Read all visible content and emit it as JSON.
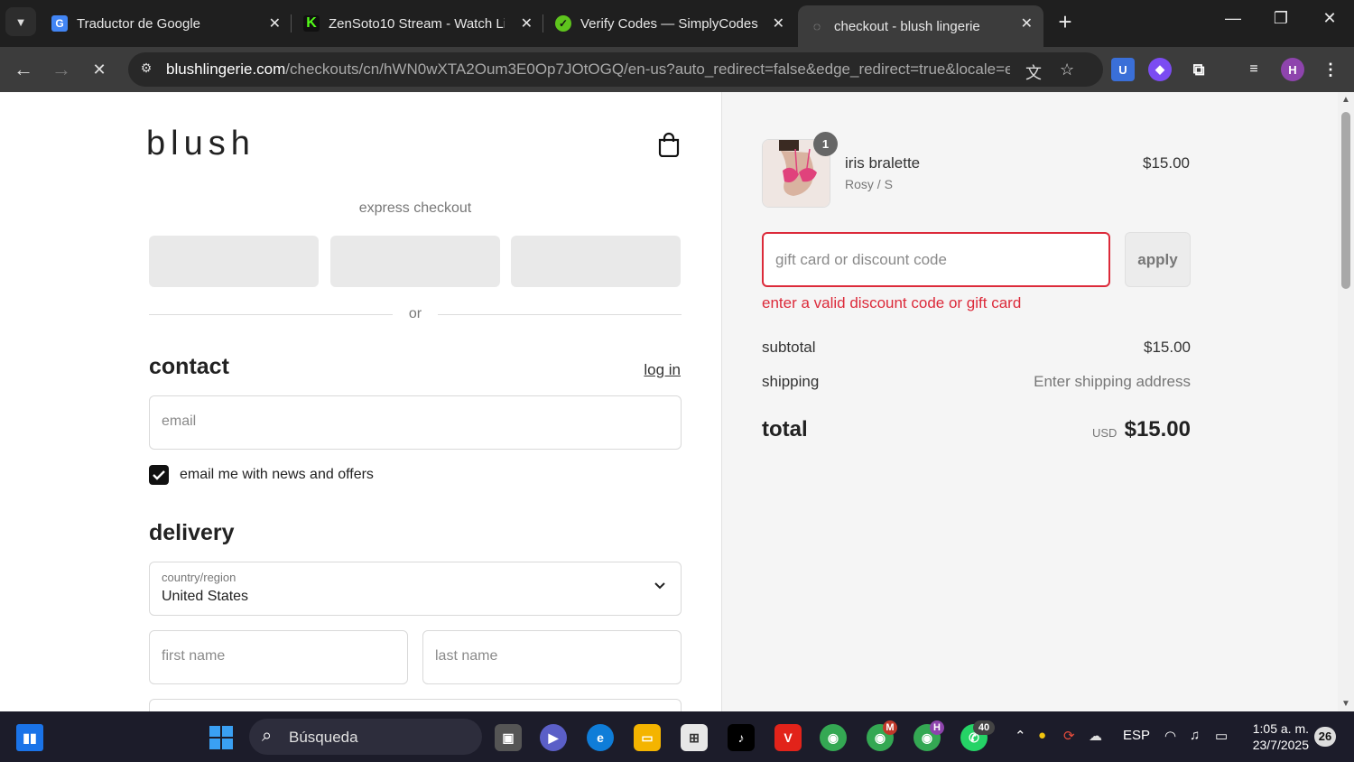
{
  "browser": {
    "tabs": [
      {
        "title": "Traductor de Google",
        "icon": "google-translate-icon"
      },
      {
        "title": "ZenSoto10 Stream - Watch Live",
        "icon": "kick-icon"
      },
      {
        "title": "Verify Codes — SimplyCodes",
        "icon": "simplycodes-icon"
      },
      {
        "title": "checkout - blush lingerie",
        "icon": "loading-icon"
      }
    ],
    "url_host": "blushlingerie.com",
    "url_path": "/checkouts/cn/hWN0wXTA2Oum3E0Op7JOtOGQ/en-us?auto_redirect=false&edge_redirect=true&locale=en-...",
    "profile_initial": "H"
  },
  "checkout": {
    "logo": "blush",
    "express_label": "express checkout",
    "or_label": "or",
    "contact_heading": "contact",
    "login_link": "log in",
    "email_placeholder": "email",
    "newsletter_label": "email me with news and offers",
    "newsletter_checked": true,
    "delivery_heading": "delivery",
    "country_label": "country/region",
    "country_value": "United States",
    "first_name_placeholder": "first name",
    "last_name_placeholder": "last name"
  },
  "summary": {
    "item": {
      "name": "iris bralette",
      "variant": "Rosy / S",
      "price": "$15.00",
      "quantity": "1"
    },
    "discount_placeholder": "gift card or discount code",
    "apply_label": "apply",
    "error_text": "enter a valid discount code or gift card",
    "subtotal_label": "subtotal",
    "subtotal_value": "$15.00",
    "shipping_label": "shipping",
    "shipping_value": "Enter shipping address",
    "total_label": "total",
    "total_currency": "USD",
    "total_value": "$15.00"
  },
  "taskbar": {
    "search_label": "Búsqueda",
    "language": "ESP",
    "time": "1:05 a. m.",
    "date": "23/7/2025",
    "notifications": "26",
    "whatsapp_badge": "40",
    "chrome_profile_m": "M",
    "chrome_profile_h": "H"
  },
  "colors": {
    "error": "#dc2a3a",
    "accent": "#111111"
  }
}
